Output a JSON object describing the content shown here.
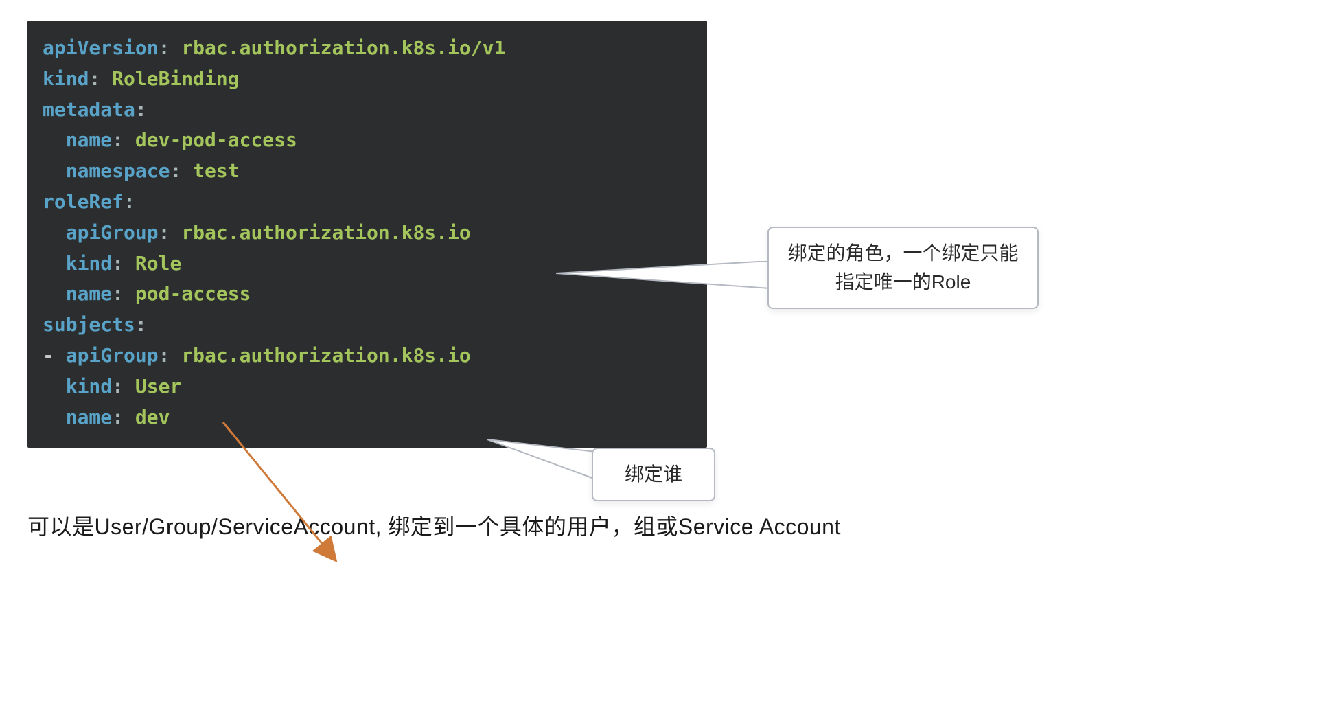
{
  "code": {
    "lines": [
      {
        "key": "apiVersion",
        "value": "rbac.authorization.k8s.io/v1"
      },
      {
        "key": "kind",
        "value": "RoleBinding"
      },
      {
        "key": "metadata",
        "value": ""
      },
      {
        "key": "name",
        "value": "dev-pod-access",
        "indent": 1
      },
      {
        "key": "namespace",
        "value": "test",
        "indent": 1
      },
      {
        "key": "roleRef",
        "value": ""
      },
      {
        "key": "apiGroup",
        "value": "rbac.authorization.k8s.io",
        "indent": 1
      },
      {
        "key": "kind",
        "value": "Role",
        "indent": 1
      },
      {
        "key": "name",
        "value": "pod-access",
        "indent": 1
      },
      {
        "key": "subjects",
        "value": ""
      },
      {
        "key": "apiGroup",
        "value": "rbac.authorization.k8s.io",
        "indent": 0,
        "dash": true
      },
      {
        "key": "kind",
        "value": "User",
        "indent": 1
      },
      {
        "key": "name",
        "value": "dev",
        "indent": 1
      }
    ]
  },
  "callouts": {
    "role": "绑定的角色，一个绑定只能指定唯一的Role",
    "subject": "绑定谁"
  },
  "bottom_text": "可以是User/Group/ServiceAccount, 绑定到一个具体的用户，组或Service Account",
  "colors": {
    "code_bg": "#2b2d2f",
    "key": "#5aa3c8",
    "value": "#a4c45c",
    "callout_border": "#b5b9c2",
    "arrow": "#d07a3a"
  }
}
